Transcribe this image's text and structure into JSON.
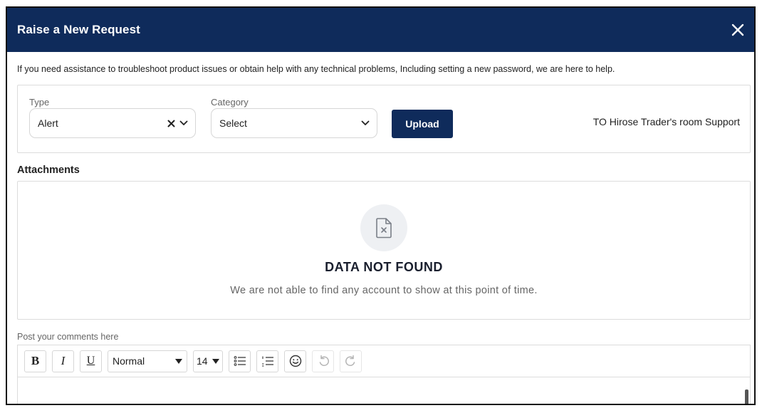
{
  "modal": {
    "title": "Raise a New Request",
    "intro": "If you need assistance to troubleshoot product issues or obtain help with any technical problems, Including setting a new password, we are here to help."
  },
  "form": {
    "type_label": "Type",
    "type_value": "Alert",
    "category_label": "Category",
    "category_value": "Select",
    "upload_label": "Upload",
    "support_text": "TO Hirose Trader's room Support"
  },
  "attachments": {
    "title": "Attachments",
    "empty_title": "DATA NOT FOUND",
    "empty_message": "We are not able to find any account to show at this point of time.",
    "empty_icon": "file-x-icon"
  },
  "editor": {
    "label": "Post your comments here",
    "toolbar": {
      "bold": "B",
      "italic": "I",
      "underline": "U",
      "format": "Normal",
      "size": "14"
    }
  },
  "colors": {
    "header_bg": "#0f2b5b",
    "primary_button": "#0f2b5b"
  }
}
